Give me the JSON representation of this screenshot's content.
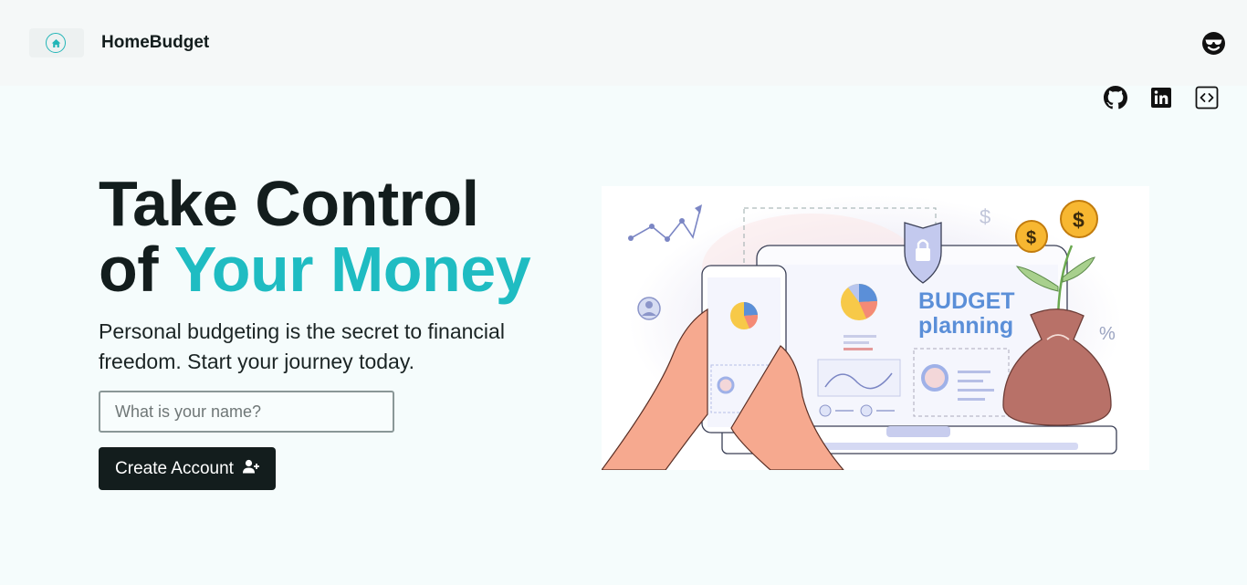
{
  "navbar": {
    "brand_name": "HomeBudget",
    "brand_icon": "home-icon",
    "profile_icon": "smiling-face-with-sunglasses-icon"
  },
  "social_links": [
    {
      "icon": "github-icon"
    },
    {
      "icon": "linkedin-icon"
    },
    {
      "icon": "code-icon"
    }
  ],
  "hero": {
    "title_line1": "Take Control",
    "title_of": "of ",
    "title_accent": "Your Money",
    "subtitle": "Personal budgeting is the secret to financial freedom. Start your journey today.",
    "name_placeholder": "What is your name?",
    "name_value": "",
    "create_button_label": "Create Account",
    "create_button_icon": "user-plus-icon"
  },
  "illustration": {
    "heading_line1": "BUDGET",
    "heading_line2": "planning",
    "percent_symbol": "%",
    "dollar_symbol": "$"
  },
  "colors": {
    "accent": "#1fbcc2",
    "dark": "#131d1d",
    "background": "#f5fcfc",
    "illustration_blue": "#5b8fd8"
  }
}
